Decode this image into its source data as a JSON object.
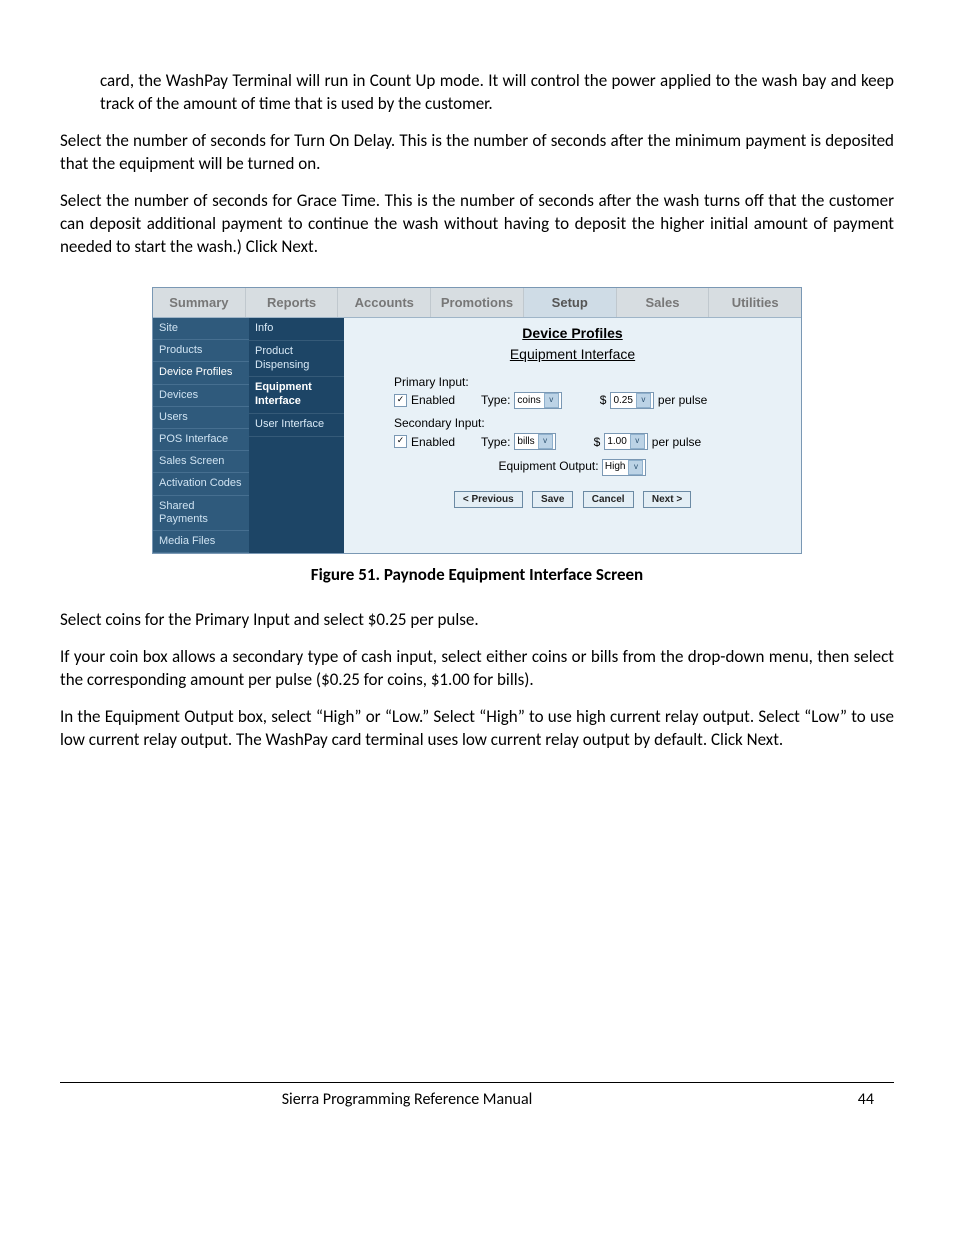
{
  "paragraphs": {
    "p1": "card, the WashPay Terminal will run in Count Up mode. It will control the power applied to the wash bay and keep track of the amount of time that is used by the customer.",
    "p2": "Select the number of seconds for Turn On Delay. This is the number of seconds after the minimum payment is deposited that the equipment will be turned on.",
    "p3": "Select the number of seconds for Grace Time. This is the number of seconds after the wash turns off that the customer can deposit additional payment to continue the wash without having to deposit the higher initial amount of payment needed to start the wash.) Click Next.",
    "p4": "Select coins for the Primary Input and select $0.25 per pulse.",
    "p5": "If your coin box allows a secondary type of cash input, select either coins or bills from the drop-down menu, then select the corresponding amount per pulse ($0.25 for coins, $1.00 for bills).",
    "p6": "In the Equipment Output box, select “High” or “Low.” Select “High” to use high current relay output. Select “Low” to use low current relay output. The WashPay card terminal uses low current relay output by default. Click Next."
  },
  "figure": {
    "caption": "Figure 51. Paynode Equipment Interface Screen",
    "topTabs": [
      "Summary",
      "Reports",
      "Accounts",
      "Promotions",
      "Setup",
      "Sales",
      "Utilities"
    ],
    "activeTopTab": "Setup",
    "sidebarMain": [
      "Site",
      "Products",
      "Device Profiles",
      "Devices",
      "Users",
      "POS Interface",
      "Sales Screen",
      "Activation Codes",
      "Shared Payments",
      "Media Files"
    ],
    "sidebarMainActive": "Device Profiles",
    "sidebarSub": [
      "Info",
      "Product Dispensing",
      "Equipment Interface",
      "User Interface"
    ],
    "sidebarSubActive": "Equipment Interface",
    "heading1": "Device Profiles",
    "heading2": "Equipment Interface",
    "primary": {
      "label": "Primary Input:",
      "enabled_label": "Enabled",
      "enabled_checked": "✓",
      "type_label": "Type:",
      "type_value": "coins",
      "currency": "$",
      "amount": "0.25",
      "per_pulse": "per pulse"
    },
    "secondary": {
      "label": "Secondary Input:",
      "enabled_label": "Enabled",
      "enabled_checked": "✓",
      "type_label": "Type:",
      "type_value": "bills",
      "currency": "$",
      "amount": "1.00",
      "per_pulse": "per pulse"
    },
    "output": {
      "label": "Equipment Output:",
      "value": "High"
    },
    "buttons": {
      "previous": "< Previous",
      "save": "Save",
      "cancel": "Cancel",
      "next": "Next >"
    }
  },
  "footer": {
    "title": "Sierra Programming Reference Manual",
    "page": "44"
  }
}
